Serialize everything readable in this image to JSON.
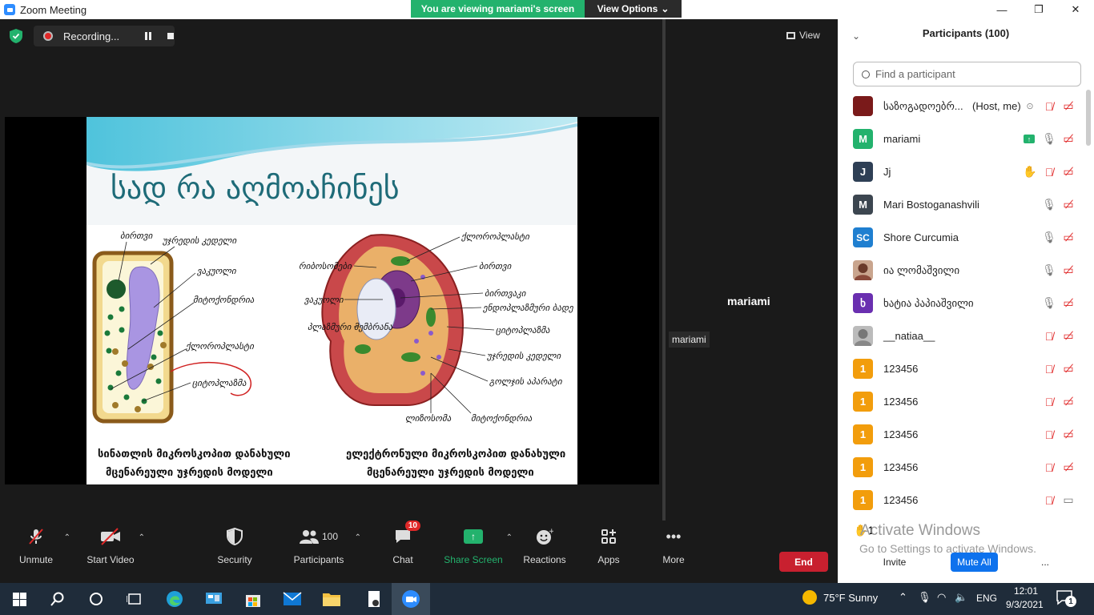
{
  "window": {
    "title": "Zoom Meeting",
    "minimize": "—",
    "maximize": "❐",
    "close": "✕"
  },
  "banner": {
    "viewing": "You are viewing mariami's screen",
    "view_options": "View Options"
  },
  "recording": {
    "label": "Recording..."
  },
  "view_button": {
    "label": "View"
  },
  "active_speaker": {
    "name": "mariami",
    "tag": "mariami"
  },
  "slide": {
    "title": "სად რა აღმოაჩინეს",
    "left_labels": [
      "ბირთვი",
      "უჯრედის კედელი",
      "ვაკუოლი",
      "მიტოქონდრია",
      "ქლოროპლასტი",
      "ციტოპლაზმა"
    ],
    "right_labels": [
      "ქლოროპლასტი",
      "რიბოსომები",
      "ბირთვი",
      "ვაკუოლი",
      "ბირთვაკი",
      "ენდოპლაზმური ბადე",
      "პლაზმური მემბრანა",
      "ციტოპლაზმა",
      "უჯრედის კედელი",
      "გოლჯის აპარატი",
      "ლიზოსომა",
      "მიტოქონდრია"
    ],
    "left_caption_1": "სინათლის მიკროსკოპით დანახული",
    "left_caption_2": "მცენარეული უჯრედის მოდელი",
    "right_caption_1": "ელექტრონული მიკროსკოპით დანახული",
    "right_caption_2": "მცენარეული უჯრედის მოდელი"
  },
  "toolbar": {
    "unmute": "Unmute",
    "start_video": "Start Video",
    "security": "Security",
    "participants": "Participants",
    "participants_count": "100",
    "chat": "Chat",
    "chat_badge": "10",
    "share_screen": "Share Screen",
    "reactions": "Reactions",
    "apps": "Apps",
    "more": "More",
    "end": "End"
  },
  "panel": {
    "header": "Participants (100)",
    "search_placeholder": "Find a participant",
    "participants": [
      {
        "initial": "",
        "name": "საზოგადოებრ...",
        "role": "(Host, me)",
        "color": "#7a1a1a"
      },
      {
        "initial": "M",
        "name": "mariami",
        "role": "",
        "color": "#23b26d"
      },
      {
        "initial": "J",
        "name": "Jj",
        "role": "",
        "color": "#2e3f55"
      },
      {
        "initial": "M",
        "name": "Mari Bostoganashvili",
        "role": "",
        "color": "#3c4650"
      },
      {
        "initial": "SC",
        "name": "Shore Curcumia",
        "role": "",
        "color": "#1f7fd0"
      },
      {
        "initial": "",
        "name": "ია ლომაშვილი",
        "role": "",
        "color": "#8a6a5a"
      },
      {
        "initial": "ხ",
        "name": "ხატია პაპიაშვილი",
        "role": "",
        "color": "#6a2fb0"
      },
      {
        "initial": "",
        "name": "__natiaa__",
        "role": "",
        "color": "#999999"
      },
      {
        "initial": "1",
        "name": "123456",
        "role": "",
        "color": "#f29d0c"
      },
      {
        "initial": "1",
        "name": "123456",
        "role": "",
        "color": "#f29d0c"
      },
      {
        "initial": "1",
        "name": "123456",
        "role": "",
        "color": "#f29d0c"
      },
      {
        "initial": "1",
        "name": "123456",
        "role": "",
        "color": "#f29d0c"
      },
      {
        "initial": "1",
        "name": "123456",
        "role": "",
        "color": "#f29d0c"
      }
    ],
    "raise_count": "1",
    "invite": "Invite",
    "mute_all": "Mute All",
    "more": "...",
    "activate_title": "Activate Windows",
    "activate_sub": "Go to Settings to activate Windows."
  },
  "taskbar": {
    "weather": "75°F  Sunny",
    "lang": "ENG",
    "time": "12:01",
    "date": "9/3/2021",
    "notif_count": "1"
  },
  "colors": {
    "accent_green": "#23b26d",
    "end_red": "#c8202f",
    "zoom_blue": "#2d8cff",
    "muted_red": "#e02828"
  }
}
